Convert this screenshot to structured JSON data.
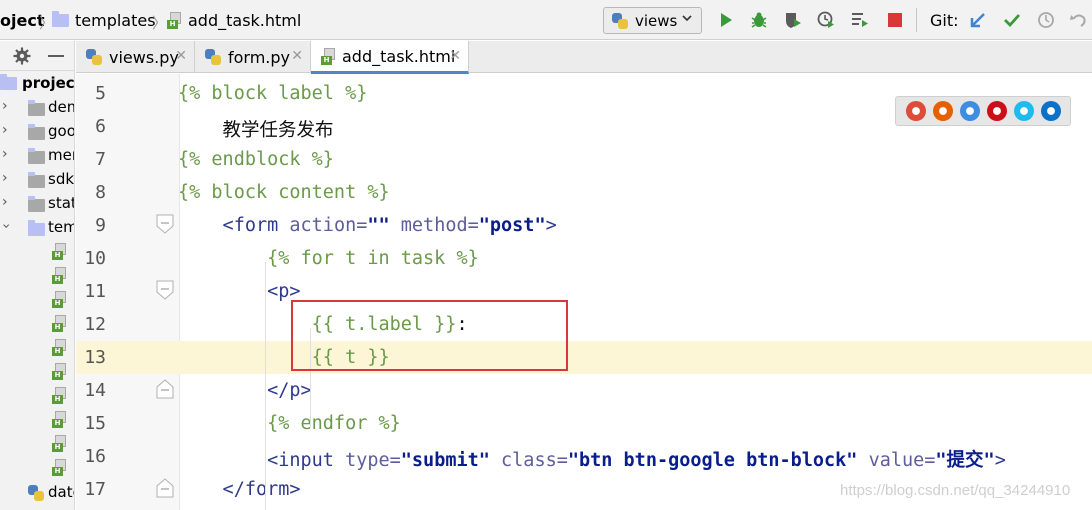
{
  "breadcrumb": {
    "project": "oject",
    "folder": "templates",
    "file": "add_task.html"
  },
  "toolbar": {
    "run_config": "views",
    "git_label": "Git:"
  },
  "project_panel": {
    "root": "project",
    "items": [
      {
        "label": "dem"
      },
      {
        "label": "goo"
      },
      {
        "label": "mer"
      },
      {
        "label": "sdk"
      },
      {
        "label": "stat"
      },
      {
        "label": "tem"
      }
    ],
    "bottom_item": "date"
  },
  "tabs": [
    {
      "label": "views.py",
      "active": false
    },
    {
      "label": "form.py",
      "active": false
    },
    {
      "label": "add_task.html",
      "active": true
    }
  ],
  "editor": {
    "lines": [
      {
        "num": "5",
        "segments": [
          {
            "cls": "tpl",
            "text": "{% block label %}"
          }
        ]
      },
      {
        "num": "6",
        "segments": [
          {
            "cls": "txt",
            "text": "    教学任务发布"
          }
        ]
      },
      {
        "num": "7",
        "segments": [
          {
            "cls": "tpl",
            "text": "{% endblock %}"
          }
        ]
      },
      {
        "num": "8",
        "segments": [
          {
            "cls": "tpl",
            "text": "{% block content %}"
          }
        ]
      },
      {
        "num": "9",
        "segments": [
          {
            "cls": "tag",
            "text": "    <form "
          },
          {
            "cls": "attr",
            "text": "action="
          },
          {
            "cls": "str",
            "text": "\"\""
          },
          {
            "cls": "attr",
            "text": " method="
          },
          {
            "cls": "str",
            "text": "\"post\""
          },
          {
            "cls": "tag",
            "text": ">"
          }
        ]
      },
      {
        "num": "10",
        "segments": [
          {
            "cls": "tpl",
            "text": "        {% for t in task %}"
          }
        ]
      },
      {
        "num": "11",
        "segments": [
          {
            "cls": "tag",
            "text": "        <p>"
          }
        ]
      },
      {
        "num": "12",
        "segments": [
          {
            "cls": "tpl",
            "text": "            {{ t.label }}"
          },
          {
            "cls": "txt",
            "text": ":"
          }
        ]
      },
      {
        "num": "13",
        "segments": [
          {
            "cls": "tpl",
            "text": "            {{ t }}"
          }
        ]
      },
      {
        "num": "14",
        "segments": [
          {
            "cls": "tag",
            "text": "        </p>"
          }
        ]
      },
      {
        "num": "15",
        "segments": [
          {
            "cls": "tpl",
            "text": "        {% endfor %}"
          }
        ]
      },
      {
        "num": "16",
        "segments": [
          {
            "cls": "tag",
            "text": "        <input "
          },
          {
            "cls": "attr",
            "text": "type="
          },
          {
            "cls": "str",
            "text": "\"submit\""
          },
          {
            "cls": "attr",
            "text": " class="
          },
          {
            "cls": "str",
            "text": "\"btn btn-google btn-block\""
          },
          {
            "cls": "attr",
            "text": " value="
          },
          {
            "cls": "str",
            "text": "\"提交\""
          },
          {
            "cls": "tag",
            "text": ">"
          }
        ]
      },
      {
        "num": "17",
        "segments": [
          {
            "cls": "tag",
            "text": "    </form>"
          }
        ]
      }
    ],
    "current_line": "13"
  },
  "browsers": [
    {
      "icon": "chrome-icon",
      "color": "#dd4b39"
    },
    {
      "icon": "firefox-icon",
      "color": "#e66000"
    },
    {
      "icon": "safari-icon",
      "color": "#3d8de0"
    },
    {
      "icon": "opera-icon",
      "color": "#cc0f16"
    },
    {
      "icon": "ie-icon",
      "color": "#1ebbee"
    },
    {
      "icon": "edge-icon",
      "color": "#0a72c9"
    }
  ],
  "watermark": "https://blog.csdn.net/qq_34244910",
  "colors": {
    "run_green": "#3a9a3a",
    "stop_red": "#d9383a",
    "git_blue": "#3d84d6",
    "git_check": "#3a9a3a",
    "highlight_box": "#d9383a",
    "current_line_bg": "#fcf5d6"
  }
}
